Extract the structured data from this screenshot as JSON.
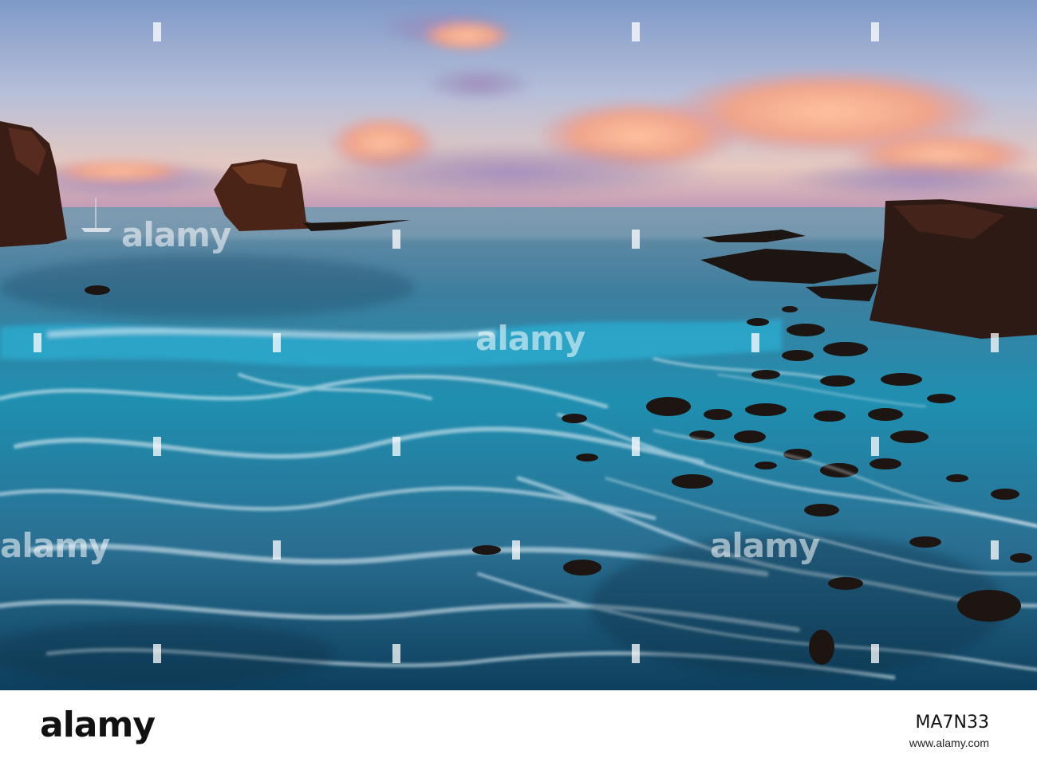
{
  "image": {
    "alt": "Sunset over a rocky coastline with a tall sea stack, distant cliffs, and swirling long-exposure surf over dark lava rocks",
    "colors": {
      "sky_top": "#7f9ac8",
      "sky_glow": "#f4c9a8",
      "cloud_pink": "#f0a48a",
      "cloud_purple": "#8a7fb0",
      "sea_teal": "#1f8fb0",
      "sea_deep": "#0d3f5c",
      "foam": "#e9f4fa",
      "rock": "#3a1e16"
    }
  },
  "watermarks": {
    "photo_text": "alamy"
  },
  "footer": {
    "logo": "alamy",
    "image_id": "MA7N33",
    "caption": "www.alamy.com"
  }
}
